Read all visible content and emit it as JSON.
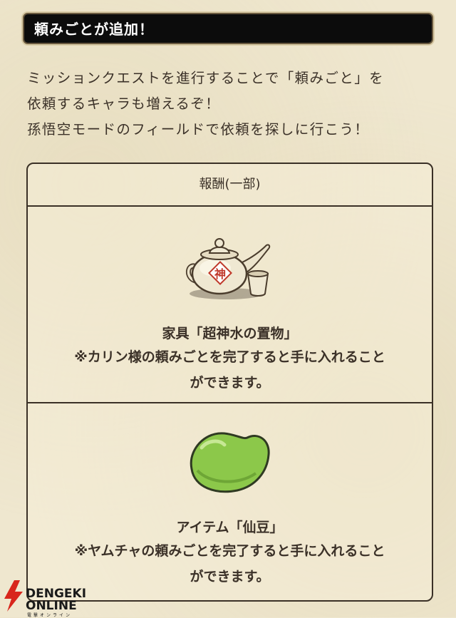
{
  "banner": {
    "title": "頼みごとが追加！"
  },
  "intro": {
    "lines": [
      "ミッションクエストを進行することで「頼みごと」を",
      "依頼するキャラも増えるぞ！",
      "孫悟空モードのフィールドで依頼を探しに行こう！"
    ]
  },
  "rewards": {
    "header": "報酬(一部)",
    "items": [
      {
        "title": "家具「超神水の置物」",
        "desc_lines": [
          "※カリン様の頼みごとを完了すると手に入れること",
          "ができます。"
        ],
        "icon": "teapot-icon",
        "kanji": "神"
      },
      {
        "title": "アイテム「仙豆」",
        "desc_lines": [
          "※ヤムチャの頼みごとを完了すると手に入れること",
          "ができます。"
        ],
        "icon": "senzu-bean-icon"
      }
    ]
  },
  "watermark": {
    "line1": "DENGEKI",
    "line2": "ONLINE",
    "line3": "電撃オンライン"
  },
  "colors": {
    "text": "#3b3128",
    "banner_bg": "#0c0c0c",
    "page_bg": "#efe7cf",
    "bean": "#8cc84a"
  }
}
